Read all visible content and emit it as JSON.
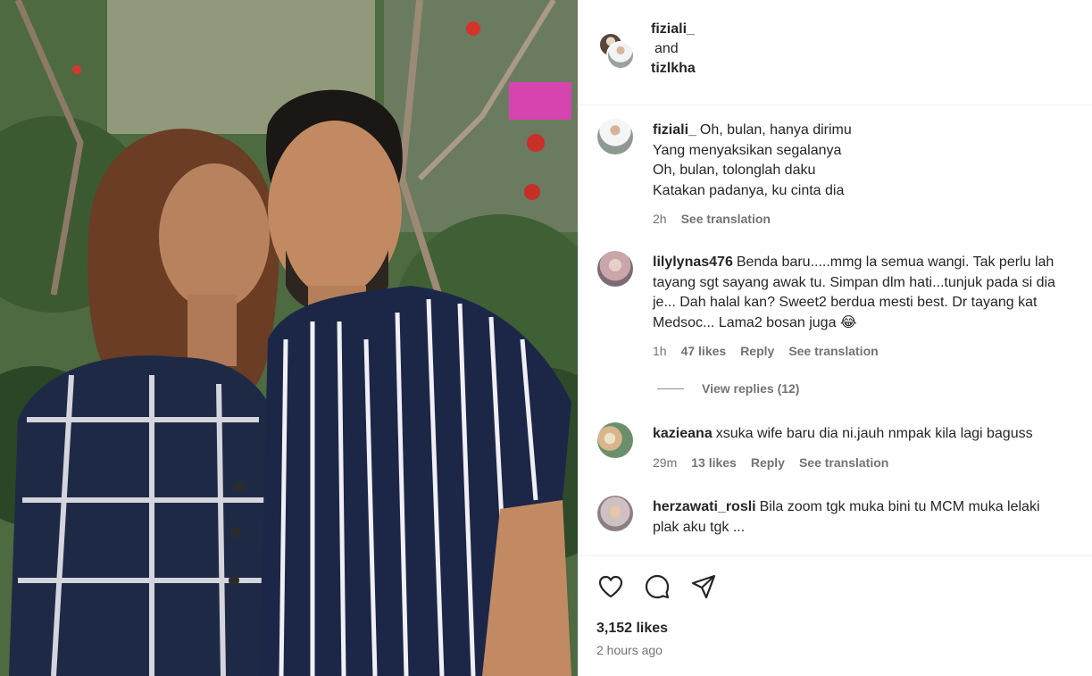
{
  "header": {
    "user1": "fiziali_",
    "and": "and",
    "user2": "tizlkha"
  },
  "comments": [
    {
      "user": "fiziali_",
      "lines": [
        "Oh, bulan, hanya dirimu",
        "Yang menyaksikan segalanya",
        "Oh, bulan, tolonglah daku",
        "Katakan padanya, ku cinta dia"
      ],
      "time": "2h",
      "likes": "",
      "reply": "",
      "translation": "See translation"
    },
    {
      "user": "lilylynas476",
      "text": "Benda baru.....mmg la semua wangi. Tak perlu lah tayang sgt sayang awak tu. Simpan dlm hati...tunjuk pada si dia je... Dah halal kan? Sweet2 berdua mesti best. Dr tayang kat Medsoc... Lama2 bosan juga 😂",
      "time": "1h",
      "likes": "47 likes",
      "reply": "Reply",
      "translation": "See translation"
    },
    {
      "user": "kazieana",
      "text": "xsuka wife baru dia ni.jauh nmpak kila lagi baguss",
      "time": "29m",
      "likes": "13 likes",
      "reply": "Reply",
      "translation": "See translation"
    },
    {
      "user": "herzawati_rosli",
      "text": "Bila zoom tgk muka bini tu MCM muka lelaki plak aku tgk ...",
      "time": "",
      "likes": "",
      "reply": "",
      "translation": ""
    }
  ],
  "view_replies": "View replies (12)",
  "actions": {
    "icons": [
      "heart-icon",
      "comment-icon",
      "share-icon"
    ]
  },
  "likes_count": "3,152 likes",
  "posted_time": "2 hours ago"
}
